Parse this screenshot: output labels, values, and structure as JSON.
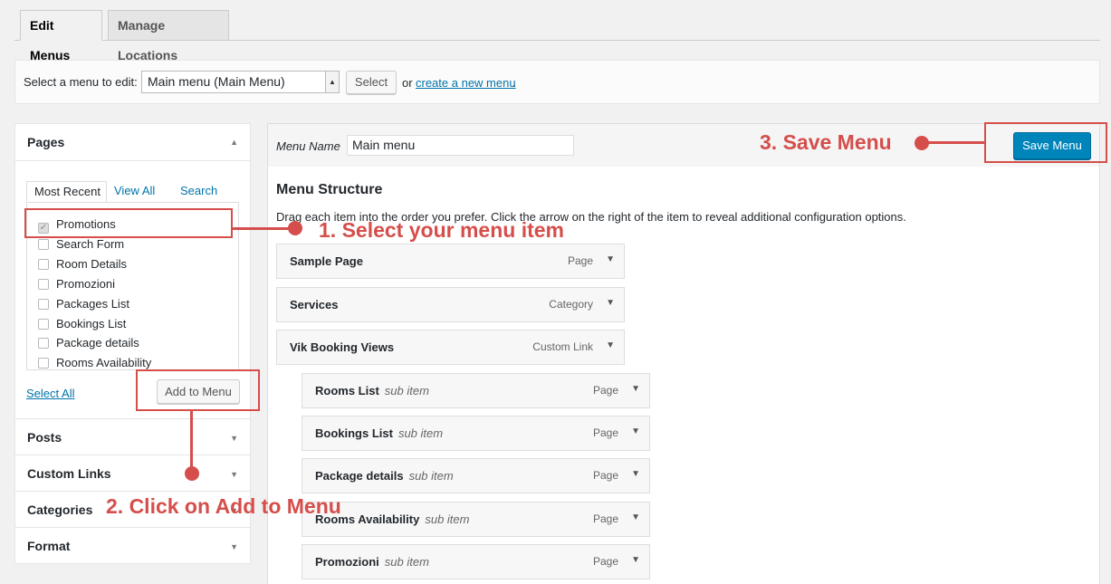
{
  "tabs": [
    {
      "label": "Edit Menus",
      "active": true
    },
    {
      "label": "Manage Locations",
      "active": false
    }
  ],
  "manage": {
    "select_label": "Select a menu to edit:",
    "selected_menu": "Main menu (Main Menu)",
    "select_button": "Select",
    "or_text": "or",
    "create_link": "create a new menu",
    "period": "."
  },
  "left_panel": {
    "pages_title": "Pages",
    "inner_tabs": [
      "Most Recent",
      "View All",
      "Search"
    ],
    "pages": [
      {
        "label": "Promotions",
        "checked": true
      },
      {
        "label": "Search Form",
        "checked": false
      },
      {
        "label": "Room Details",
        "checked": false
      },
      {
        "label": "Promozioni",
        "checked": false
      },
      {
        "label": "Packages List",
        "checked": false
      },
      {
        "label": "Bookings List",
        "checked": false
      },
      {
        "label": "Package details",
        "checked": false
      },
      {
        "label": "Rooms Availability",
        "checked": false
      }
    ],
    "select_all": "Select All",
    "add_to_menu": "Add to Menu",
    "sections": [
      "Posts",
      "Custom Links",
      "Categories",
      "Format"
    ]
  },
  "menu": {
    "name_label": "Menu Name",
    "name_value": "Main menu",
    "save_button": "Save Menu",
    "structure_title": "Menu Structure",
    "structure_desc": "Drag each item into the order you prefer. Click the arrow on the right of the item to reveal additional configuration options.",
    "items": [
      {
        "title": "Sample Page",
        "sub": "",
        "type": "Page"
      },
      {
        "title": "Services",
        "sub": "",
        "type": "Category"
      },
      {
        "title": "Vik Booking Views",
        "sub": "",
        "type": "Custom Link"
      },
      {
        "title": "Rooms List",
        "sub": "sub item",
        "type": "Page"
      },
      {
        "title": "Bookings List",
        "sub": "sub item",
        "type": "Page"
      },
      {
        "title": "Package details",
        "sub": "sub item",
        "type": "Page"
      },
      {
        "title": "Rooms Availability",
        "sub": "sub item",
        "type": "Page"
      },
      {
        "title": "Promozioni",
        "sub": "sub item",
        "type": "Page"
      }
    ]
  },
  "annotations": {
    "step1": "1. Select your menu item",
    "step2": "2. Click on Add to Menu",
    "step3": "3. Save Menu",
    "color": "#d54e4b"
  },
  "icons": {
    "collapse": "triangle-up-icon",
    "expand": "triangle-down-icon",
    "checkmark": "checkmark-icon"
  }
}
